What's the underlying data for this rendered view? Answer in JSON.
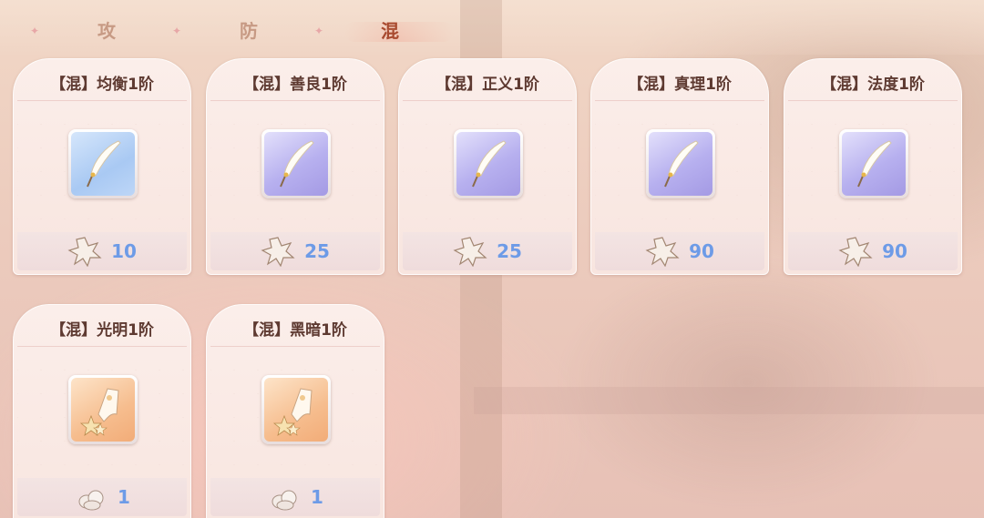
{
  "tabs": [
    {
      "label": "攻",
      "active": false
    },
    {
      "label": "防",
      "active": false
    },
    {
      "label": "混",
      "active": true
    }
  ],
  "cards": [
    {
      "title": "【混】均衡1阶",
      "icon": "quill-feather-icon",
      "icon_bg": "blue",
      "cost": "10",
      "cost_icon": "star-shard-icon"
    },
    {
      "title": "【混】善良1阶",
      "icon": "quill-feather-icon",
      "icon_bg": "purple",
      "cost": "25",
      "cost_icon": "star-shard-icon"
    },
    {
      "title": "【混】正义1阶",
      "icon": "quill-feather-icon",
      "icon_bg": "purple",
      "cost": "25",
      "cost_icon": "star-shard-icon"
    },
    {
      "title": "【混】真理1阶",
      "icon": "quill-feather-icon",
      "icon_bg": "purple",
      "cost": "90",
      "cost_icon": "star-shard-icon"
    },
    {
      "title": "【混】法度1阶",
      "icon": "quill-feather-icon",
      "icon_bg": "purple",
      "cost": "90",
      "cost_icon": "star-shard-icon"
    },
    {
      "title": "【混】光明1阶",
      "icon": "crystal-scroll-icon",
      "icon_bg": "orange",
      "cost": "1",
      "cost_icon": "crystal-cluster-icon"
    },
    {
      "title": "【混】黑暗1阶",
      "icon": "crystal-scroll-icon",
      "icon_bg": "orange",
      "cost": "1",
      "cost_icon": "crystal-cluster-icon"
    }
  ],
  "colors": {
    "cost_text": "#6d9be7",
    "title_text": "#5e3a31",
    "active_tab": "#a84a2f",
    "inactive_tab": "#c79a84"
  }
}
